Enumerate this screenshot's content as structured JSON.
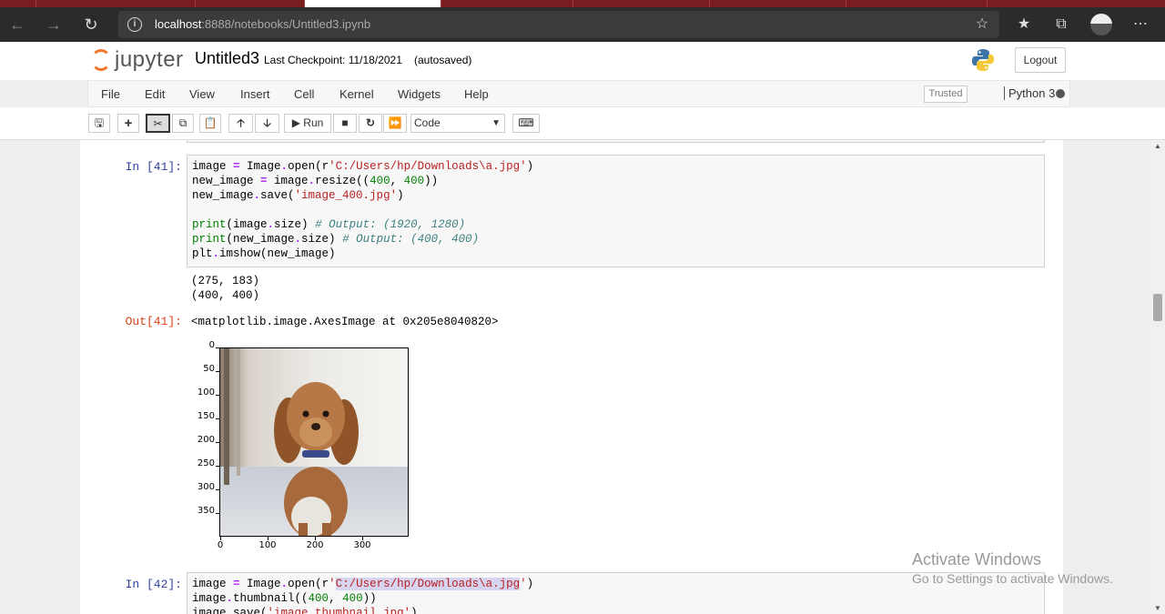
{
  "browser": {
    "url_host": "localhost",
    "url_rest": ":8888/notebooks/Untitled3.ipynb"
  },
  "header": {
    "logo_text": "jupyter",
    "notebook_title": "Untitled3",
    "checkpoint": "Last Checkpoint: 11/18/2021",
    "autosave": "(autosaved)",
    "logout_label": "Logout"
  },
  "menu": {
    "items": [
      "File",
      "Edit",
      "View",
      "Insert",
      "Cell",
      "Kernel",
      "Widgets",
      "Help"
    ],
    "trusted": "Trusted",
    "kernel": "Python 3"
  },
  "toolbar": {
    "run_label": "Run",
    "cell_type": "Code"
  },
  "cells": {
    "in41_prompt": "In [41]:",
    "out41_prompt": "Out[41]:",
    "stdout": [
      "(275, 183)",
      "(400, 400)"
    ],
    "out41_repr": "<matplotlib.image.AxesImage at 0x205e8040820>",
    "in42_prompt": "In [42]:"
  },
  "plot": {
    "yticks": [
      "0",
      "50",
      "100",
      "150",
      "200",
      "250",
      "300",
      "350"
    ],
    "xticks": [
      "0",
      "100",
      "200",
      "300"
    ],
    "ylim": [
      400,
      0
    ],
    "xlim": [
      0,
      400
    ]
  },
  "watermark": {
    "line1": "Activate Windows",
    "line2": "Go to Settings to activate Windows."
  },
  "colors": {
    "jupyter_orange": "#f37726",
    "browser_frame": "#7a1d20"
  }
}
